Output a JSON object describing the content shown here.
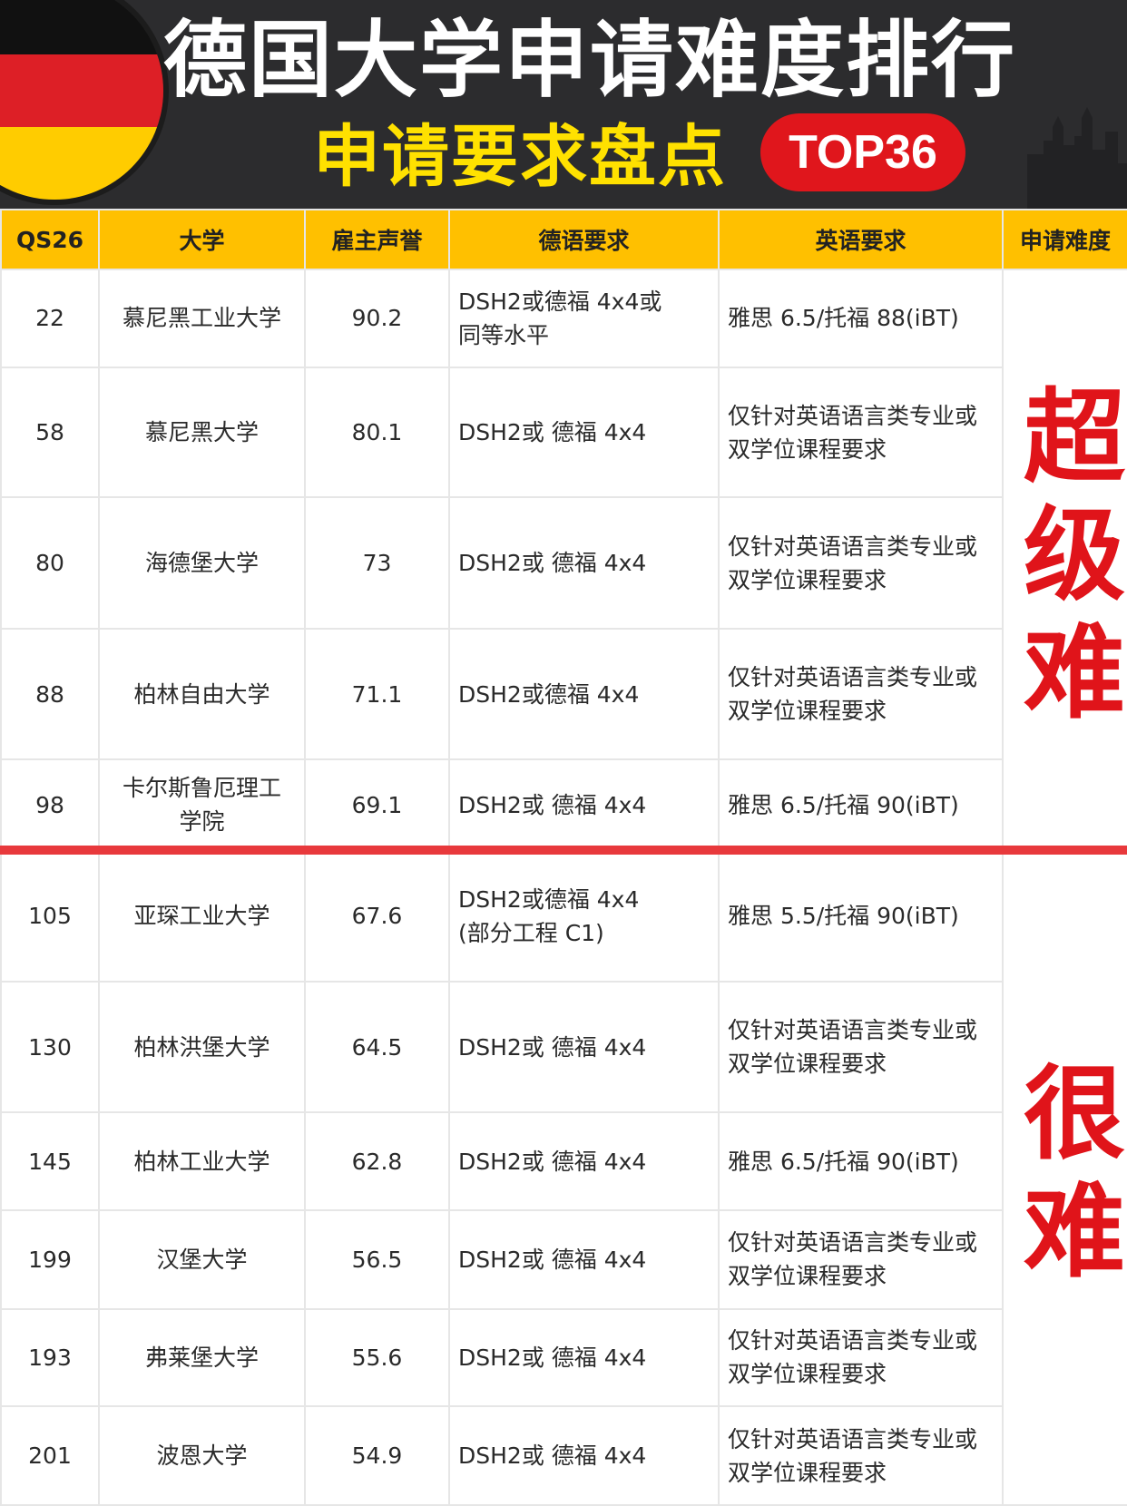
{
  "header": {
    "title": "德国大学申请难度排行",
    "subtitle": "申请要求盘点",
    "badge": "TOP36"
  },
  "colors": {
    "banner_bg": "#2c2c2e",
    "title": "#ffffff",
    "subtitle": "#ffe100",
    "badge_bg": "#e0161c",
    "header_row": "#ffc000",
    "difficulty_text": "#e0141a",
    "divider": "#e8393c"
  },
  "icons": [
    "germany-flag-icon",
    "city-skyline-icon"
  ],
  "table": {
    "headers": [
      "QS26",
      "大学",
      "雇主声誉",
      "德语要求",
      "英语要求",
      "申请难度"
    ],
    "difficulty_labels": [
      "超级难",
      "很难"
    ],
    "rows": [
      {
        "qs": "22",
        "name": "慕尼黑工业大学",
        "rep": "90.2",
        "de": "DSH2或德福 4x4或\n同等水平",
        "en": "雅思 6.5/托福 88(iBT)"
      },
      {
        "qs": "58",
        "name": "慕尼黑大学",
        "rep": "80.1",
        "de": "DSH2或 德福 4x4",
        "en": "仅针对英语语言类专业或\n双学位课程要求"
      },
      {
        "qs": "80",
        "name": "海德堡大学",
        "rep": "73",
        "de": "DSH2或 德福 4x4",
        "en": "仅针对英语语言类专业或\n双学位课程要求"
      },
      {
        "qs": "88",
        "name": "柏林自由大学",
        "rep": "71.1",
        "de": "DSH2或德福 4x4",
        "en": "仅针对英语语言类专业或\n双学位课程要求"
      },
      {
        "qs": "98",
        "name": "卡尔斯鲁厄理工\n学院",
        "rep": "69.1",
        "de": "DSH2或 德福 4x4",
        "en": "雅思 6.5/托福 90(iBT)"
      },
      {
        "qs": "105",
        "name": "亚琛工业大学",
        "rep": "67.6",
        "de": "DSH2或德福 4x4\n(部分工程 C1)",
        "en": "雅思 5.5/托福 90(iBT)"
      },
      {
        "qs": "130",
        "name": "柏林洪堡大学",
        "rep": "64.5",
        "de": "DSH2或 德福 4x4",
        "en": "仅针对英语语言类专业或\n双学位课程要求"
      },
      {
        "qs": "145",
        "name": "柏林工业大学",
        "rep": "62.8",
        "de": "DSH2或 德福 4x4",
        "en": "雅思 6.5/托福 90(iBT)"
      },
      {
        "qs": "199",
        "name": "汉堡大学",
        "rep": "56.5",
        "de": "DSH2或 德福 4x4",
        "en": "仅针对英语语言类专业或\n双学位课程要求"
      },
      {
        "qs": "193",
        "name": "弗莱堡大学",
        "rep": "55.6",
        "de": "DSH2或 德福 4x4",
        "en": "仅针对英语语言类专业或\n双学位课程要求"
      },
      {
        "qs": "201",
        "name": "波恩大学",
        "rep": "54.9",
        "de": "DSH2或 德福 4x4",
        "en": "仅针对英语语言类专业或\n双学位课程要求"
      }
    ]
  }
}
